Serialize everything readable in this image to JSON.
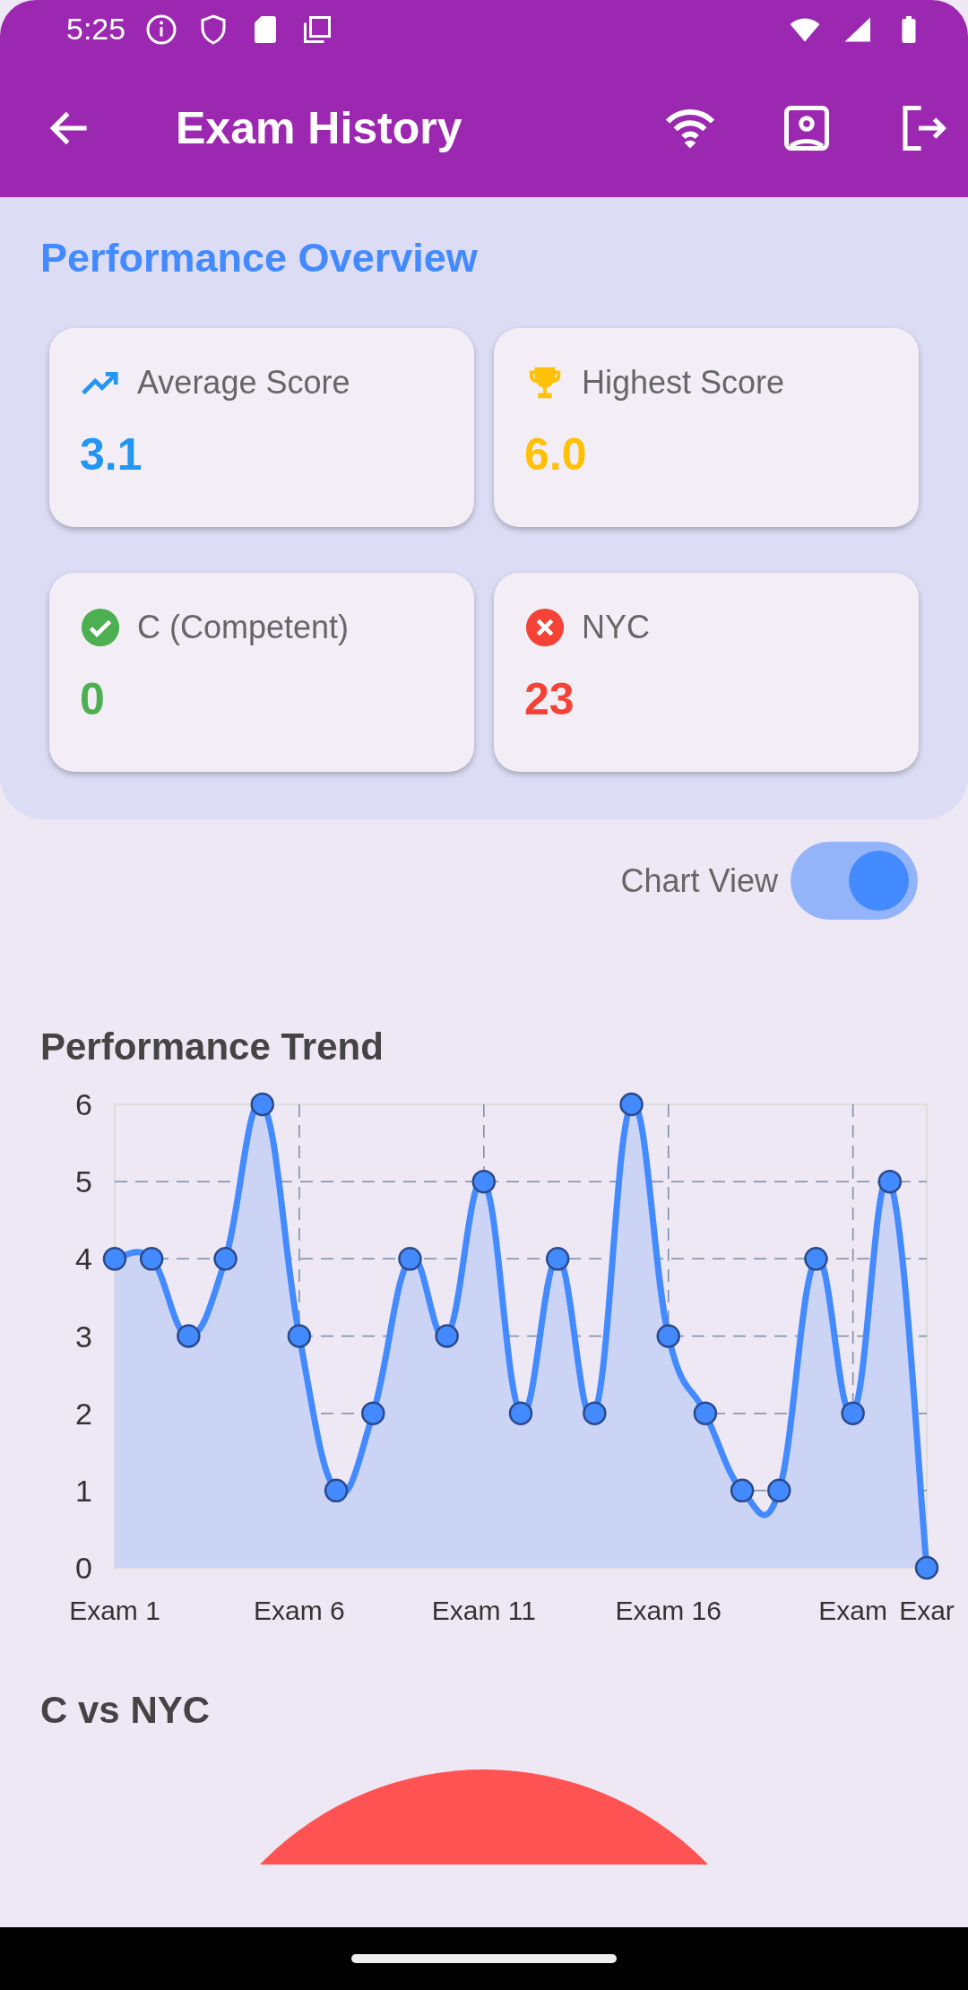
{
  "status_bar": {
    "time": "5:25"
  },
  "app_bar": {
    "title": "Exam History"
  },
  "overview": {
    "title": "Performance Overview",
    "cards": [
      {
        "kind": "average",
        "label": "Average Score",
        "value": "3.1",
        "color": "#2196f3"
      },
      {
        "kind": "highest",
        "label": "Highest Score",
        "value": "6.0",
        "color": "#ffc107"
      },
      {
        "kind": "competent",
        "label": "C (Competent)",
        "value": "0",
        "color": "#4caf50"
      },
      {
        "kind": "nyc",
        "label": "NYC",
        "value": "23",
        "color": "#f44336"
      }
    ]
  },
  "chart_toggle": {
    "label": "Chart View",
    "on": true
  },
  "trend": {
    "title": "Performance Trend",
    "chart_data": {
      "type": "area",
      "categories": [
        "Exam 1",
        null,
        null,
        null,
        null,
        "Exam 6",
        null,
        null,
        null,
        null,
        "Exam 11",
        null,
        null,
        null,
        null,
        "Exam 16",
        null,
        null,
        null,
        null,
        "Exam",
        null,
        "Exar"
      ],
      "grid": true,
      "series": [
        {
          "color": "#448aff",
          "values": [
            4,
            4,
            3,
            4,
            6,
            3,
            1,
            2,
            4,
            3,
            5,
            2,
            4,
            2,
            6,
            3,
            2,
            1,
            1,
            4,
            2,
            5,
            0
          ]
        }
      ],
      "ylim": [
        0,
        6
      ],
      "yticks": [
        0,
        1,
        2,
        3,
        4,
        5,
        6
      ]
    }
  },
  "ratio": {
    "title": "C vs NYC",
    "chart_data": {
      "type": "pie",
      "series": [
        {
          "color": "#ff5252",
          "values": [
            0,
            100
          ]
        }
      ]
    }
  }
}
